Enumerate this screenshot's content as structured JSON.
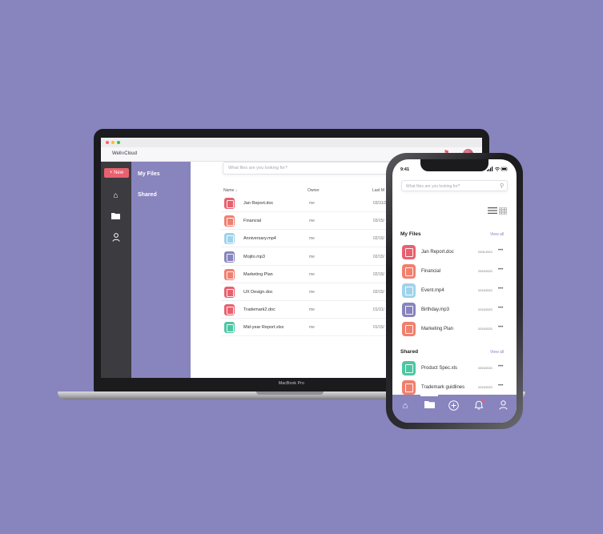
{
  "colors": {
    "background": "#8884bd",
    "accent": "#8884bd",
    "new_button": "#e8616f",
    "rail": "#3b3b40"
  },
  "laptop": {
    "model_label": "MacBook Pro",
    "logo": {
      "prefix": "Well",
      "mark": "o",
      "suffix": "Cloud"
    },
    "new_button_label": "+ New",
    "nav": {
      "my_files": "My Files",
      "shared": "Shared"
    },
    "search_placeholder": "What files are you looking for?",
    "table": {
      "headers": {
        "name": "Name ↓",
        "owner": "Owner",
        "modified": "Last M"
      },
      "rows": [
        {
          "name": "Jan Report.doc",
          "owner": "me",
          "date": "03/31/2",
          "color": "#e8616f",
          "type": "doc"
        },
        {
          "name": "Financial",
          "owner": "me",
          "date": "03/15/",
          "color": "#f0806f",
          "type": "folder"
        },
        {
          "name": "Anniversary.mp4",
          "owner": "me",
          "date": "02/15/",
          "color": "#9fd3ea",
          "type": "video"
        },
        {
          "name": "Mojito.mp3",
          "owner": "me",
          "date": "02/15/",
          "color": "#8884bd",
          "type": "audio"
        },
        {
          "name": "Marketing Plan",
          "owner": "me",
          "date": "02/15/",
          "color": "#f0806f",
          "type": "folder"
        },
        {
          "name": "UX Design.doc",
          "owner": "me",
          "date": "02/15/",
          "color": "#e8616f",
          "type": "doc"
        },
        {
          "name": "Trademark2.doc",
          "owner": "me",
          "date": "01/31/",
          "color": "#e8616f",
          "type": "doc"
        },
        {
          "name": "Mid-year Report.xlsx",
          "owner": "me",
          "date": "01/15/",
          "color": "#4cc7a3",
          "type": "sheet"
        }
      ]
    }
  },
  "phone": {
    "time": "9:41",
    "status_icons": "signal wifi battery",
    "search_placeholder": "What files are you looking for?",
    "view_toggle_icons": [
      "list-icon",
      "grid-icon"
    ],
    "sections": {
      "my_files": {
        "title": "My Files",
        "view_all": "View all",
        "rows": [
          {
            "name": "Jan Report.doc",
            "date": "03/31/2023",
            "color": "#e8616f",
            "type": "doc"
          },
          {
            "name": "Financial",
            "date": "03/15/2023",
            "color": "#f0806f",
            "type": "folder"
          },
          {
            "name": "Event.mp4",
            "date": "02/15/2023",
            "color": "#9fd3ea",
            "type": "video"
          },
          {
            "name": "Birthday.mp3",
            "date": "02/15/2023",
            "color": "#8884bd",
            "type": "audio"
          },
          {
            "name": "Marketing Plan",
            "date": "02/15/2023",
            "color": "#f0806f",
            "type": "folder"
          }
        ]
      },
      "shared": {
        "title": "Shared",
        "view_all": "View all",
        "rows": [
          {
            "name": "Product Spec.xls",
            "date": "03/15/2023",
            "color": "#4cc7a3",
            "type": "sheet"
          },
          {
            "name": "Trademark guidlines",
            "date": "02/15/2023",
            "color": "#f0806f",
            "type": "folder"
          }
        ]
      }
    },
    "tabbar_icons": [
      "home-icon",
      "folder-icon",
      "add-icon",
      "notification-icon",
      "profile-icon"
    ]
  }
}
